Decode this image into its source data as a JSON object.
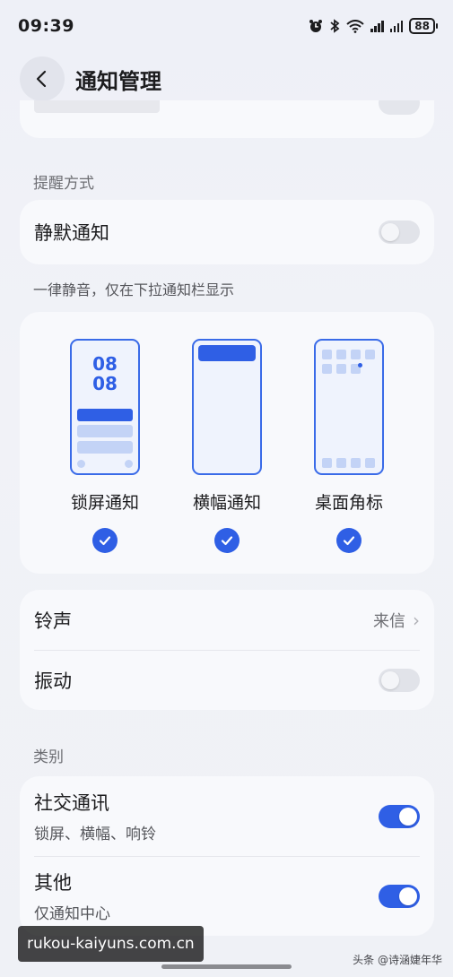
{
  "status_bar": {
    "time": "09:39",
    "battery": "88",
    "icons": [
      "alarm-icon",
      "bluetooth-icon",
      "wifi-icon",
      "signal-icon",
      "signal-icon",
      "battery-icon"
    ]
  },
  "header": {
    "title": "通知管理",
    "back_icon": "back-arrow-icon"
  },
  "reminder": {
    "section_label": "提醒方式",
    "silent_label": "静默通知",
    "silent_enabled": false,
    "silent_desc": "一律静音，仅在下拉通知栏显示"
  },
  "styles": [
    {
      "label": "锁屏通知",
      "checked": true,
      "preview_time": [
        "08",
        "08"
      ]
    },
    {
      "label": "横幅通知",
      "checked": true
    },
    {
      "label": "桌面角标",
      "checked": true
    }
  ],
  "sound": {
    "ringtone_label": "铃声",
    "ringtone_value": "来信",
    "vibration_label": "振动",
    "vibration_enabled": false
  },
  "category": {
    "section_label": "类别",
    "items": [
      {
        "label": "社交通讯",
        "sub": "锁屏、横幅、响铃",
        "enabled": true
      },
      {
        "label": "其他",
        "sub": "仅通知中心",
        "enabled": true
      }
    ]
  },
  "overlay": {
    "watermark": "rukou-kaiyuns.com.cn",
    "source": "头条 @诗涵婕年华"
  },
  "colors": {
    "accent": "#2f5fe5",
    "background": "#eef0f7",
    "card": "#f8f9fc"
  }
}
